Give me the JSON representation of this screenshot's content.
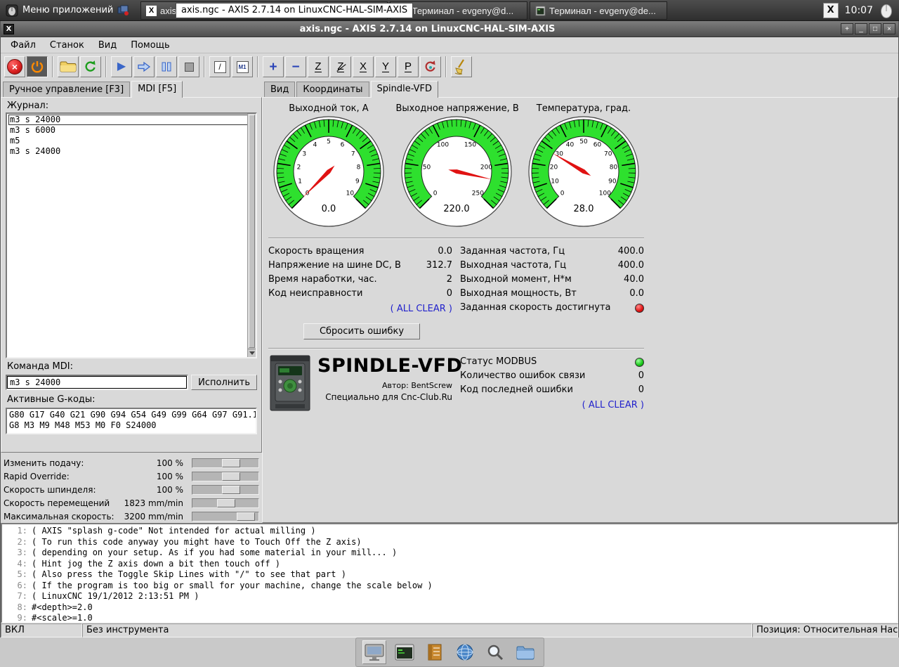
{
  "taskbar": {
    "menu_label": "Меню приложений",
    "axis_window_label": "axis",
    "axis_icon_glyph": "X",
    "tooltip": "axis.ngc - AXIS 2.7.14 on LinuxCNC-HAL-SIM-AXIS",
    "terminal1_label": "[Терминал - evgeny@d...",
    "terminal2_label": "Терминал - evgeny@de...",
    "layout_badge": "X",
    "clock": "10:07"
  },
  "window": {
    "title": "axis.ngc - AXIS 2.7.14 on LinuxCNC-HAL-SIM-AXIS",
    "icon_glyph": "X",
    "btn_rollup": "+",
    "btn_min": "_",
    "btn_max": "□",
    "btn_close": "×"
  },
  "menubar": {
    "items": [
      {
        "id": "file",
        "label": "Файл"
      },
      {
        "id": "machine",
        "label": "Станок"
      },
      {
        "id": "view",
        "label": "Вид"
      },
      {
        "id": "help",
        "label": "Помощь"
      }
    ]
  },
  "toolbar": {
    "estop_glyph": "×",
    "skip_glyph": "/",
    "m1_glyph": "M1",
    "zoom_in_glyph": "+",
    "zoom_out_glyph": "−",
    "view_z": "Z",
    "view_z2": "Z",
    "view_x": "X",
    "view_y": "Y",
    "view_p": "P"
  },
  "left_panel": {
    "tab_manual": "Ручное управление [F3]",
    "tab_mdi": "MDI [F5]",
    "history_label": "Журнал:",
    "history": [
      "m3 s 24000",
      "m3 s 6000",
      "m5",
      "m3 s 24000"
    ],
    "mdi_label": "Команда MDI:",
    "mdi_value": "m3 s 24000",
    "execute_label": "Исполнить",
    "gcodes_label": "Активные G-коды:",
    "gcodes_line1": "G80 G17 G40 G21 G90 G94 G54 G49 G99 G64 G97 G91.1",
    "gcodes_line2": "G8 M3 M9 M48 M53 M0 F0 S24000"
  },
  "sliders": [
    {
      "id": "feed-override",
      "label": "Изменить подачу:",
      "value": "100 %",
      "pct": 62
    },
    {
      "id": "rapid-override",
      "label": "Rapid Override:",
      "value": "100 %",
      "pct": 62
    },
    {
      "id": "spindle-override",
      "label": "Скорость шпинделя:",
      "value": "100 %",
      "pct": 62
    },
    {
      "id": "jog-speed",
      "label": "Скорость перемещений",
      "value": "1823 mm/min",
      "pct": 52
    },
    {
      "id": "max-velocity",
      "label": "Максимальная скорость:",
      "value": "3200 mm/min",
      "pct": 93
    }
  ],
  "right_panel": {
    "tab_preview": "Вид",
    "tab_dro": "Координаты",
    "tab_vfd": "Spindle-VFD"
  },
  "vfd": {
    "gauges": [
      {
        "id": "output-current",
        "title": "Выходной ток, А",
        "min": 0,
        "max": 10,
        "major_step": 1,
        "minor_step": 0.2,
        "tick_labels": [
          "0",
          "1",
          "2",
          "3",
          "4",
          "5",
          "6",
          "7",
          "8",
          "9",
          "10"
        ],
        "value": 0.0,
        "display": "0.0"
      },
      {
        "id": "output-voltage",
        "title": "Выходное напряжение, В",
        "min": 0,
        "max": 250,
        "major_step": 50,
        "minor_step": 5,
        "tick_labels": [
          "0",
          "50",
          "100",
          "150",
          "200",
          "250"
        ],
        "value": 220.0,
        "display": "220.0"
      },
      {
        "id": "temperature",
        "title": "Температура, град.",
        "min": 0,
        "max": 100,
        "major_step": 10,
        "minor_step": 2,
        "tick_labels": [
          "0",
          "10",
          "20",
          "30",
          "40",
          "50",
          "60",
          "70",
          "80",
          "90",
          "100"
        ],
        "value": 28.0,
        "display": "28.0"
      }
    ],
    "stats_left": [
      {
        "label": "Скорость вращения",
        "value": "0.0"
      },
      {
        "label": "Напряжение на шине DC, В",
        "value": "312.7"
      },
      {
        "label": "Время наработки, час.",
        "value": "2"
      },
      {
        "label": "Код неисправности",
        "value": "0"
      }
    ],
    "stats_right": [
      {
        "label": "Заданная частота, Гц",
        "value": "400.0"
      },
      {
        "label": "Выходная частота, Гц",
        "value": "400.0"
      },
      {
        "label": "Выходной момент, Н*м",
        "value": "40.0"
      },
      {
        "label": "Выходная мощность, Вт",
        "value": "0.0"
      }
    ],
    "all_clear": "( ALL CLEAR )",
    "speed_reached_label": "Заданная скорость достигнута",
    "reset_button": "Сбросить ошибку",
    "brand": "SPINDLE-VFD",
    "author": "Автор: BentScrew",
    "dedication": "Специально для Cnc-Club.Ru",
    "modbus_label": "Статус MODBUS",
    "comm_errors_label": "Количество ошибок связи",
    "comm_errors_value": "0",
    "last_error_label": "Код последней ошибки",
    "last_error_value": "0"
  },
  "gcode": {
    "lines": [
      {
        "num": "1:",
        "text": "( AXIS \"splash g-code\" Not intended for actual milling )"
      },
      {
        "num": "2:",
        "text": "( To run this code anyway you might have to Touch Off the Z axis)"
      },
      {
        "num": "3:",
        "text": "( depending on your setup. As if you had some material in your mill... )"
      },
      {
        "num": "4:",
        "text": "( Hint jog the Z axis down a bit then touch off )"
      },
      {
        "num": "5:",
        "text": "( Also press the Toggle Skip Lines with \"/\" to see that part )"
      },
      {
        "num": "6:",
        "text": "( If the program is too big or small for your machine, change the scale below )"
      },
      {
        "num": "7:",
        "text": "( LinuxCNC 19/1/2012 2:13:51 PM )"
      },
      {
        "num": "8:",
        "text": "#<depth>=2.0"
      },
      {
        "num": "9:",
        "text": "#<scale>=1.0"
      }
    ]
  },
  "statusbar": {
    "power": "ВКЛ",
    "tool": "Без инструмента",
    "position": "Позиция: Относительная Насто"
  },
  "dock": {
    "icons": [
      "desktop",
      "terminal",
      "documents",
      "web-browser",
      "search",
      "file-manager"
    ]
  }
}
